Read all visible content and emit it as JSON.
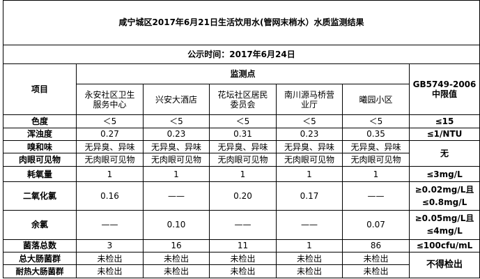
{
  "title": "咸宁城区2017年6月21日生活饮用水(管网末梢水）水质监测结果",
  "publish": "公示时间：2017年6月24日",
  "headers": {
    "item": "项目",
    "points": "监测点",
    "standard_line1": "GB5749-2006",
    "standard_line2": "中限值"
  },
  "sites": [
    {
      "line1": "永安社区卫生",
      "line2": "服务中心"
    },
    {
      "line1": "兴安大酒店",
      "line2": ""
    },
    {
      "line1": "花坛社区居民",
      "line2": "委员会"
    },
    {
      "line1": "南川源马桥营",
      "line2": "业厅"
    },
    {
      "line1": "曦园小区",
      "line2": ""
    }
  ],
  "rows": {
    "color": {
      "name": "色度",
      "values": [
        "＜5",
        "＜5",
        "＜5",
        "＜5",
        "＜5"
      ],
      "limit": "≤15"
    },
    "turbidity": {
      "name": "浑浊度",
      "values": [
        "0.27",
        "0.23",
        "0.31",
        "0.23",
        "0.35"
      ],
      "limit": "≤1/NTU"
    },
    "odor": {
      "name": "嗅和味",
      "values": [
        "无异臭、异味",
        "无异臭、异味",
        "无异臭、异味",
        "无异臭、异味",
        "无异臭、异味"
      ]
    },
    "visible": {
      "name": "肉眼可见物",
      "values": [
        "无肉眼可见物",
        "无肉眼可见物",
        "无肉眼可见物",
        "无肉眼可见物",
        "无肉眼可见物"
      ]
    },
    "odor_visible_limit": "无",
    "oxygen": {
      "name": "耗氧量",
      "values": [
        "1",
        "1",
        "1",
        "1",
        "1"
      ],
      "limit": "≤3mg/L"
    },
    "chlorine_dioxide": {
      "name": "二氧化氯",
      "values": [
        "0.16",
        "——",
        "0.20",
        "0.17",
        "——"
      ],
      "limit_line1": "≥0.02mg/L且",
      "limit_line2": "≤0.8mg/L"
    },
    "residual_chlorine": {
      "name": "余氯",
      "values": [
        "——",
        "0.10",
        "——",
        "——",
        "0.07"
      ],
      "limit_line1": "≥0.05mg/L且",
      "limit_line2": "≤4mg/L"
    },
    "colony": {
      "name": "菌落总数",
      "values": [
        "3",
        "16",
        "11",
        "1",
        "86"
      ],
      "limit": "≤100cfu/mL"
    },
    "coliform": {
      "name": "总大肠菌群",
      "values": [
        "未检出",
        "未检出",
        "未检出",
        "未检出",
        "未检出"
      ]
    },
    "thermo_coliform": {
      "name": "耐热大肠菌群",
      "values": [
        "未检出",
        "未检出",
        "未检出",
        "未检出",
        "未检出"
      ]
    },
    "coliform_limit": "不得检出"
  }
}
